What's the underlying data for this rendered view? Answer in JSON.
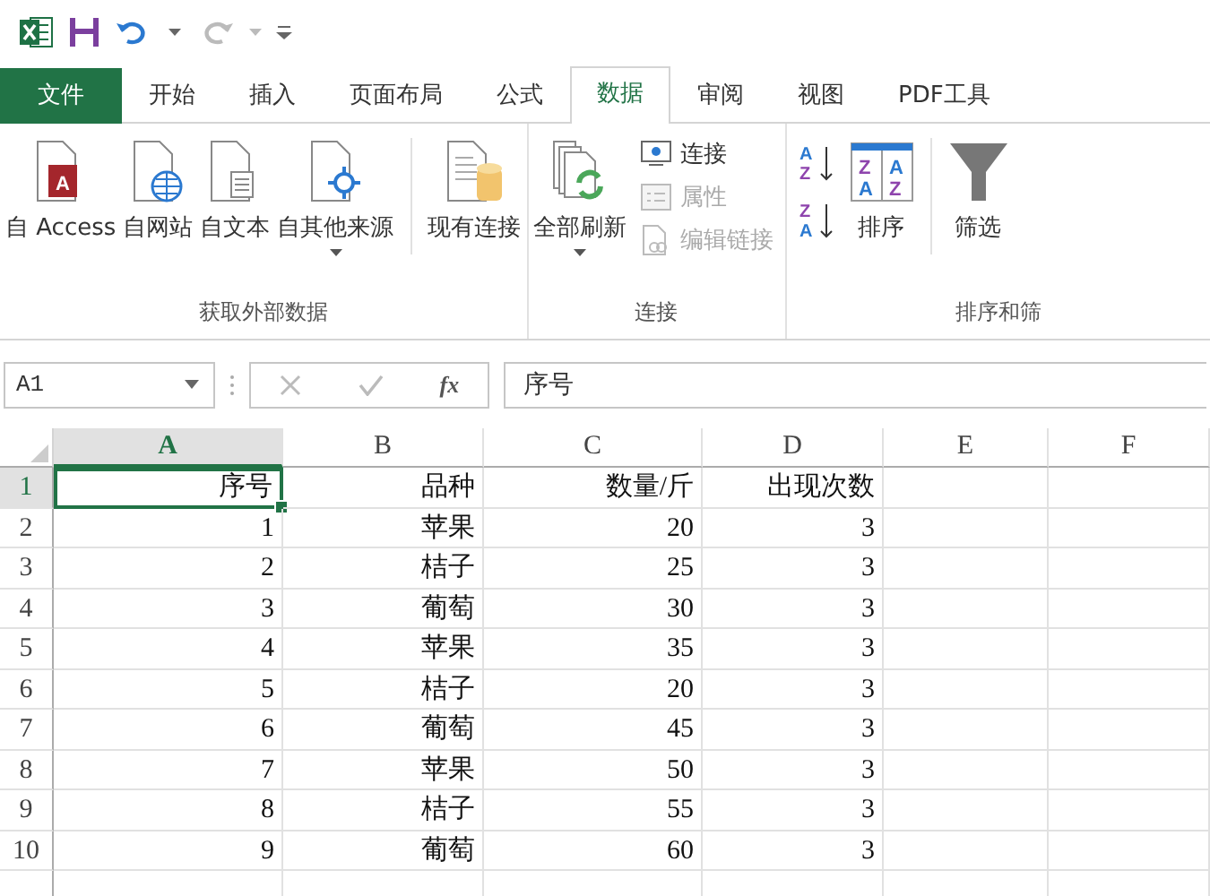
{
  "quick_access": {
    "redo_disabled": true
  },
  "file_tab": "文件",
  "tabs": [
    {
      "label": "开始",
      "selected": false
    },
    {
      "label": "插入",
      "selected": false
    },
    {
      "label": "页面布局",
      "selected": false
    },
    {
      "label": "公式",
      "selected": false
    },
    {
      "label": "数据",
      "selected": true
    },
    {
      "label": "审阅",
      "selected": false
    },
    {
      "label": "视图",
      "selected": false
    },
    {
      "label": "PDF工具",
      "selected": false
    }
  ],
  "ribbon_groups": [
    {
      "label": "获取外部数据",
      "items": [
        {
          "kind": "large",
          "label": "自 Access",
          "letter": "A",
          "dropdown": false
        },
        {
          "kind": "large",
          "label": "自网站",
          "dropdown": false
        },
        {
          "kind": "large",
          "label": "自文本",
          "dropdown": false
        },
        {
          "kind": "large",
          "label": "自其他来源",
          "dropdown": true
        },
        {
          "kind": "separator"
        },
        {
          "kind": "large",
          "label": "现有连接",
          "dropdown": false
        }
      ]
    },
    {
      "label": "连接",
      "items": [
        {
          "kind": "large",
          "label": "全部刷新",
          "dropdown": true
        },
        {
          "kind": "stack",
          "items": [
            {
              "label": "连接",
              "disabled": false
            },
            {
              "label": "属性",
              "disabled": true
            },
            {
              "label": "编辑链接",
              "disabled": true
            }
          ]
        }
      ]
    },
    {
      "label": "排序和筛",
      "items": [
        {
          "kind": "sortstack",
          "items": [
            {
              "letters": [
                "A",
                "Z"
              ]
            },
            {
              "letters": [
                "Z",
                "A"
              ]
            }
          ]
        },
        {
          "kind": "large",
          "label": "排序",
          "letters": [
            "Z",
            "A",
            "A",
            "Z"
          ],
          "dropdown": false
        },
        {
          "kind": "separator"
        },
        {
          "kind": "large",
          "label": "筛选",
          "dropdown": false
        }
      ]
    }
  ],
  "formula_bar": {
    "name_box": "A1",
    "fx": "fx",
    "content": "序号"
  },
  "sheet": {
    "columns": [
      {
        "label": "A",
        "selected": true
      },
      {
        "label": "B",
        "selected": false
      },
      {
        "label": "C",
        "selected": false
      },
      {
        "label": "D",
        "selected": false
      },
      {
        "label": "E",
        "selected": false
      },
      {
        "label": "F",
        "selected": false
      }
    ],
    "rows": [
      {
        "header": "1",
        "selected": true,
        "cells": [
          "序号",
          "品种",
          "数量/斤",
          "出现次数"
        ]
      },
      {
        "header": "2",
        "selected": false,
        "cells": [
          "1",
          "苹果",
          "20",
          "3"
        ]
      },
      {
        "header": "3",
        "selected": false,
        "cells": [
          "2",
          "桔子",
          "25",
          "3"
        ]
      },
      {
        "header": "4",
        "selected": false,
        "cells": [
          "3",
          "葡萄",
          "30",
          "3"
        ]
      },
      {
        "header": "5",
        "selected": false,
        "cells": [
          "4",
          "苹果",
          "35",
          "3"
        ]
      },
      {
        "header": "6",
        "selected": false,
        "cells": [
          "5",
          "桔子",
          "20",
          "3"
        ]
      },
      {
        "header": "7",
        "selected": false,
        "cells": [
          "6",
          "葡萄",
          "45",
          "3"
        ]
      },
      {
        "header": "8",
        "selected": false,
        "cells": [
          "7",
          "苹果",
          "50",
          "3"
        ]
      },
      {
        "header": "9",
        "selected": false,
        "cells": [
          "8",
          "桔子",
          "55",
          "3"
        ]
      },
      {
        "header": "10",
        "selected": false,
        "cells": [
          "9",
          "葡萄",
          "60",
          "3"
        ]
      }
    ]
  }
}
